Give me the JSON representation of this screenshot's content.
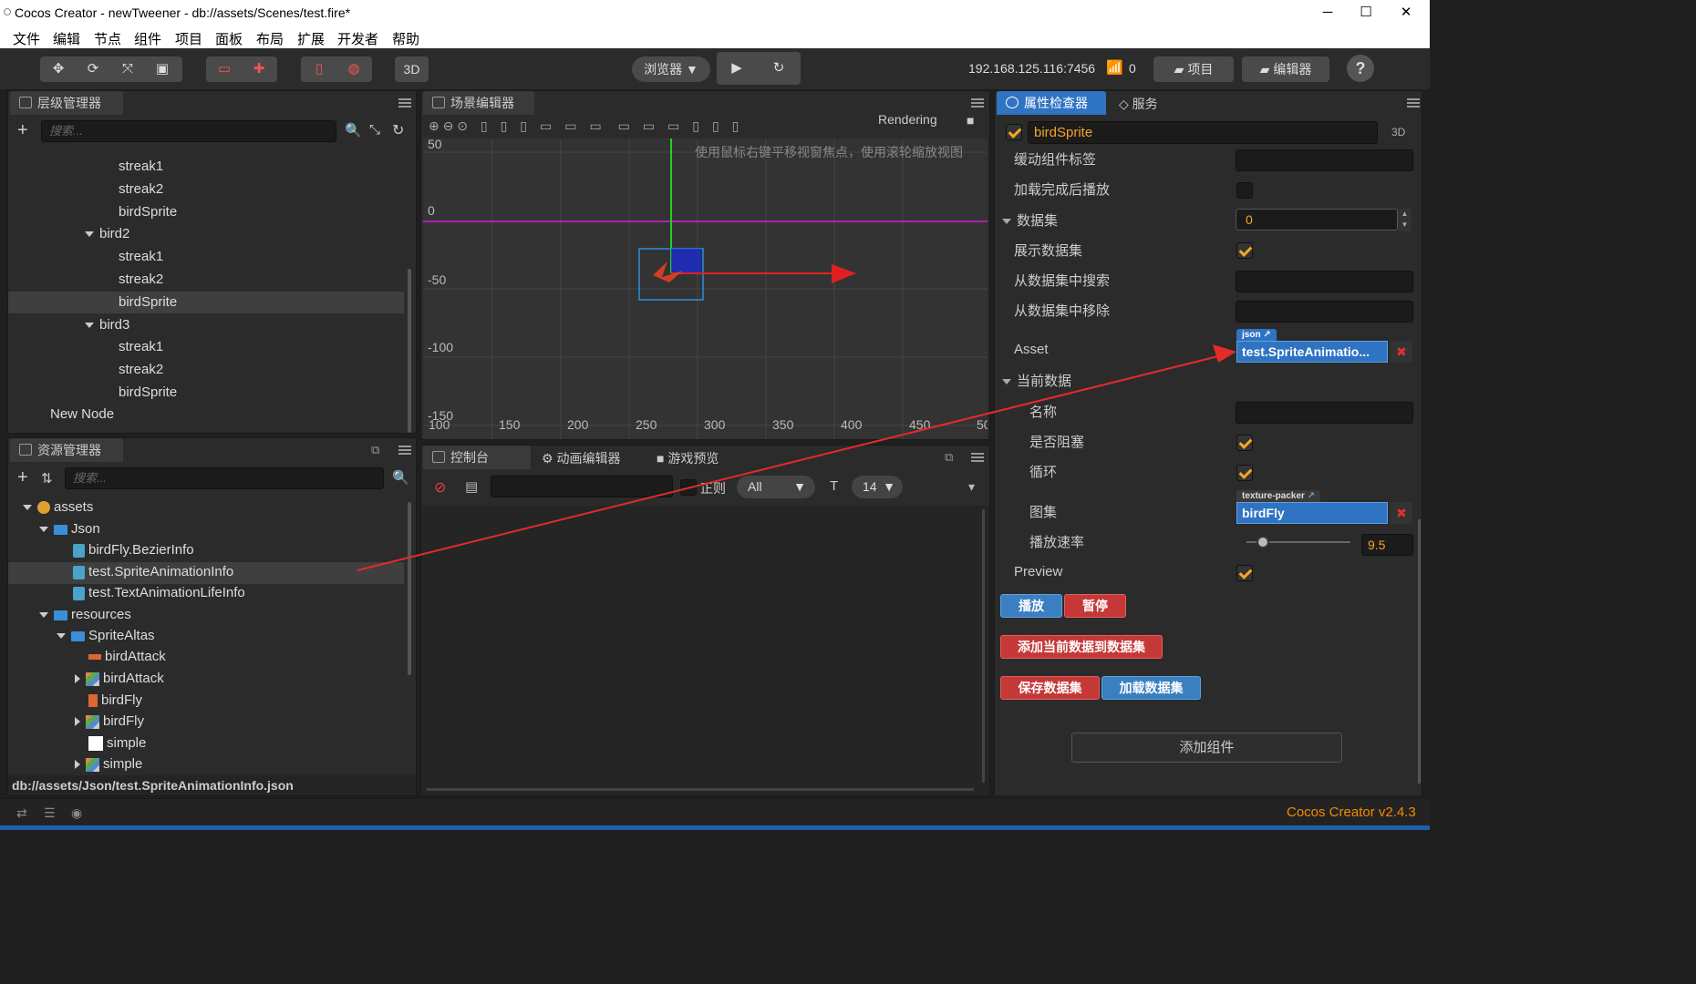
{
  "window": {
    "title": "Cocos Creator - newTweener - db://assets/Scenes/test.fire*",
    "min": "─",
    "max": "☐",
    "close": "✕"
  },
  "menu": [
    "文件",
    "编辑",
    "节点",
    "组件",
    "项目",
    "面板",
    "布局",
    "扩展",
    "开发者",
    "帮助"
  ],
  "toolbar": {
    "mode_3d": "3D",
    "browser": "浏览器 ▼",
    "ip": "192.168.125.116:7456",
    "count": "0",
    "project_btn": "项目",
    "editor_btn": "编辑器",
    "help": "?"
  },
  "hierarchy": {
    "tab": "层级管理器",
    "search_placeholder": "搜索...",
    "items": [
      {
        "label": "streak1"
      },
      {
        "label": "streak2"
      },
      {
        "label": "birdSprite"
      },
      {
        "label": "bird2"
      },
      {
        "label": "streak1"
      },
      {
        "label": "streak2"
      },
      {
        "label": "birdSprite"
      },
      {
        "label": "bird3"
      },
      {
        "label": "streak1"
      },
      {
        "label": "streak2"
      },
      {
        "label": "birdSprite"
      },
      {
        "label": "New Node"
      }
    ]
  },
  "assets": {
    "tab": "资源管理器",
    "search_placeholder": "搜索...",
    "items": [
      {
        "label": "assets"
      },
      {
        "label": "Json"
      },
      {
        "label": "birdFly.BezierInfo"
      },
      {
        "label": "test.SpriteAnimationInfo"
      },
      {
        "label": "test.TextAnimationLifeInfo"
      },
      {
        "label": "resources"
      },
      {
        "label": "SpriteAltas"
      },
      {
        "label": "birdAttack"
      },
      {
        "label": "birdAttack"
      },
      {
        "label": "birdFly"
      },
      {
        "label": "birdFly"
      },
      {
        "label": "simple"
      },
      {
        "label": "simple"
      }
    ],
    "path": "db://assets/Json/test.SpriteAnimationInfo.json"
  },
  "scene": {
    "tab": "场景编辑器",
    "rendering": "Rendering",
    "hint": "使用鼠标右键平移视窗焦点，使用滚轮缩放视图",
    "y_labels": [
      "50",
      "0",
      "-50",
      "-100",
      "-150"
    ],
    "x_labels": [
      "100",
      "150",
      "200",
      "250",
      "300",
      "350",
      "400",
      "450",
      "50"
    ]
  },
  "console": {
    "tabs": [
      "控制台",
      "动画编辑器",
      "游戏预览"
    ],
    "regex": "正则",
    "filter": "All",
    "font_size": "14"
  },
  "inspector": {
    "tabs": [
      "属性检查器",
      "服务"
    ],
    "node_name": "birdSprite",
    "mode_3d": "3D",
    "labels": {
      "tween_tag": "缓动组件标签",
      "autoplay": "加载完成后播放",
      "dataset": "数据集",
      "show_dataset": "展示数据集",
      "search_dataset": "从数据集中搜索",
      "remove_dataset": "从数据集中移除",
      "asset": "Asset",
      "current": "当前数据",
      "name": "名称",
      "blocking": "是否阻塞",
      "loop": "循环",
      "atlas": "图集",
      "speed": "播放速率",
      "preview": "Preview"
    },
    "dataset_value": "0",
    "asset_type": "json",
    "asset_value": "test.SpriteAnimatio...",
    "atlas_type": "texture-packer",
    "atlas_value": "birdFly",
    "speed_value": "9.5",
    "buttons": {
      "play": "播放",
      "pause": "暂停",
      "add_current": "添加当前数据到数据集",
      "save": "保存数据集",
      "load": "加载数据集",
      "add_component": "添加组件"
    }
  },
  "status": {
    "version": "Cocos Creator v2.4.3"
  },
  "colors": {
    "accent": "#f5a623",
    "selection": "#3a7fc0",
    "danger": "#c43838",
    "version_text": "#f58a00"
  }
}
